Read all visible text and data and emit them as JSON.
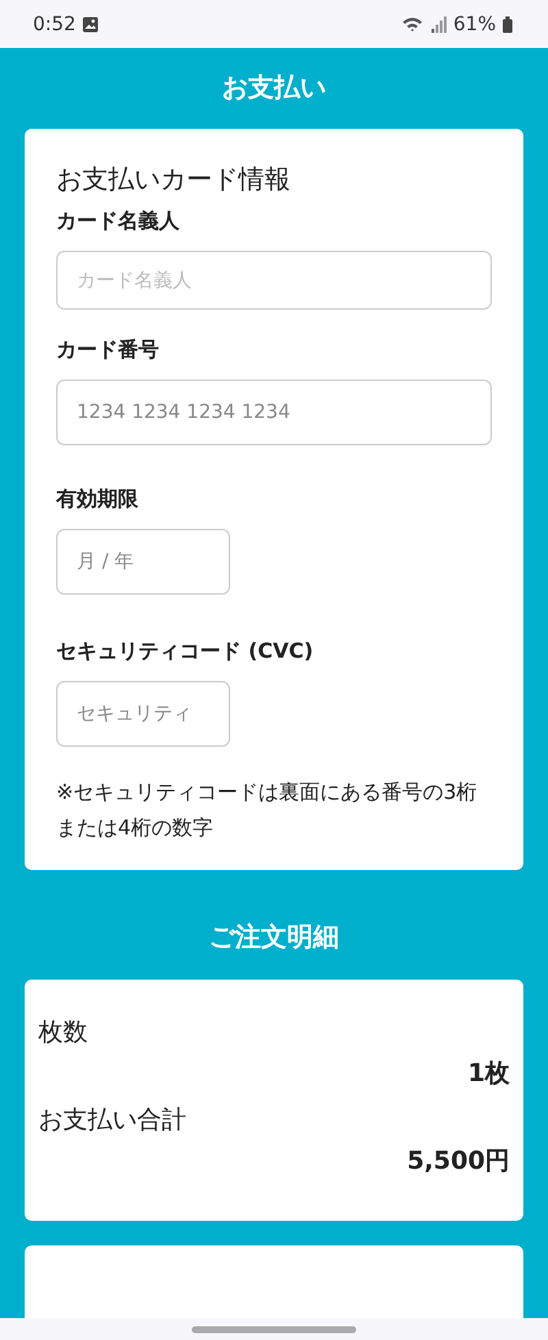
{
  "status_bar": {
    "time": "0:52",
    "battery": "61%"
  },
  "header": {
    "title": "お支払い"
  },
  "card_form": {
    "title": "お支払いカード情報",
    "fields": [
      {
        "label": "カード名義人",
        "placeholder": "カード名義人",
        "kind": "wide"
      },
      {
        "label": "カード番号",
        "placeholder": "1234 1234 1234 1234",
        "kind": "wide"
      },
      {
        "label": "有効期限",
        "placeholder": "月 / 年",
        "kind": "short"
      },
      {
        "label": "セキュリティコード (CVC)",
        "placeholder": "セキュリティ",
        "kind": "short"
      }
    ],
    "note": "※セキュリティコードは裏面にある番号の3桁または4桁の数字"
  },
  "order_section": {
    "title": "ご注文明細",
    "rows": [
      {
        "label": "枚数",
        "value": "1枚"
      },
      {
        "label": "お支払い合計",
        "value": "5,500円"
      }
    ]
  }
}
